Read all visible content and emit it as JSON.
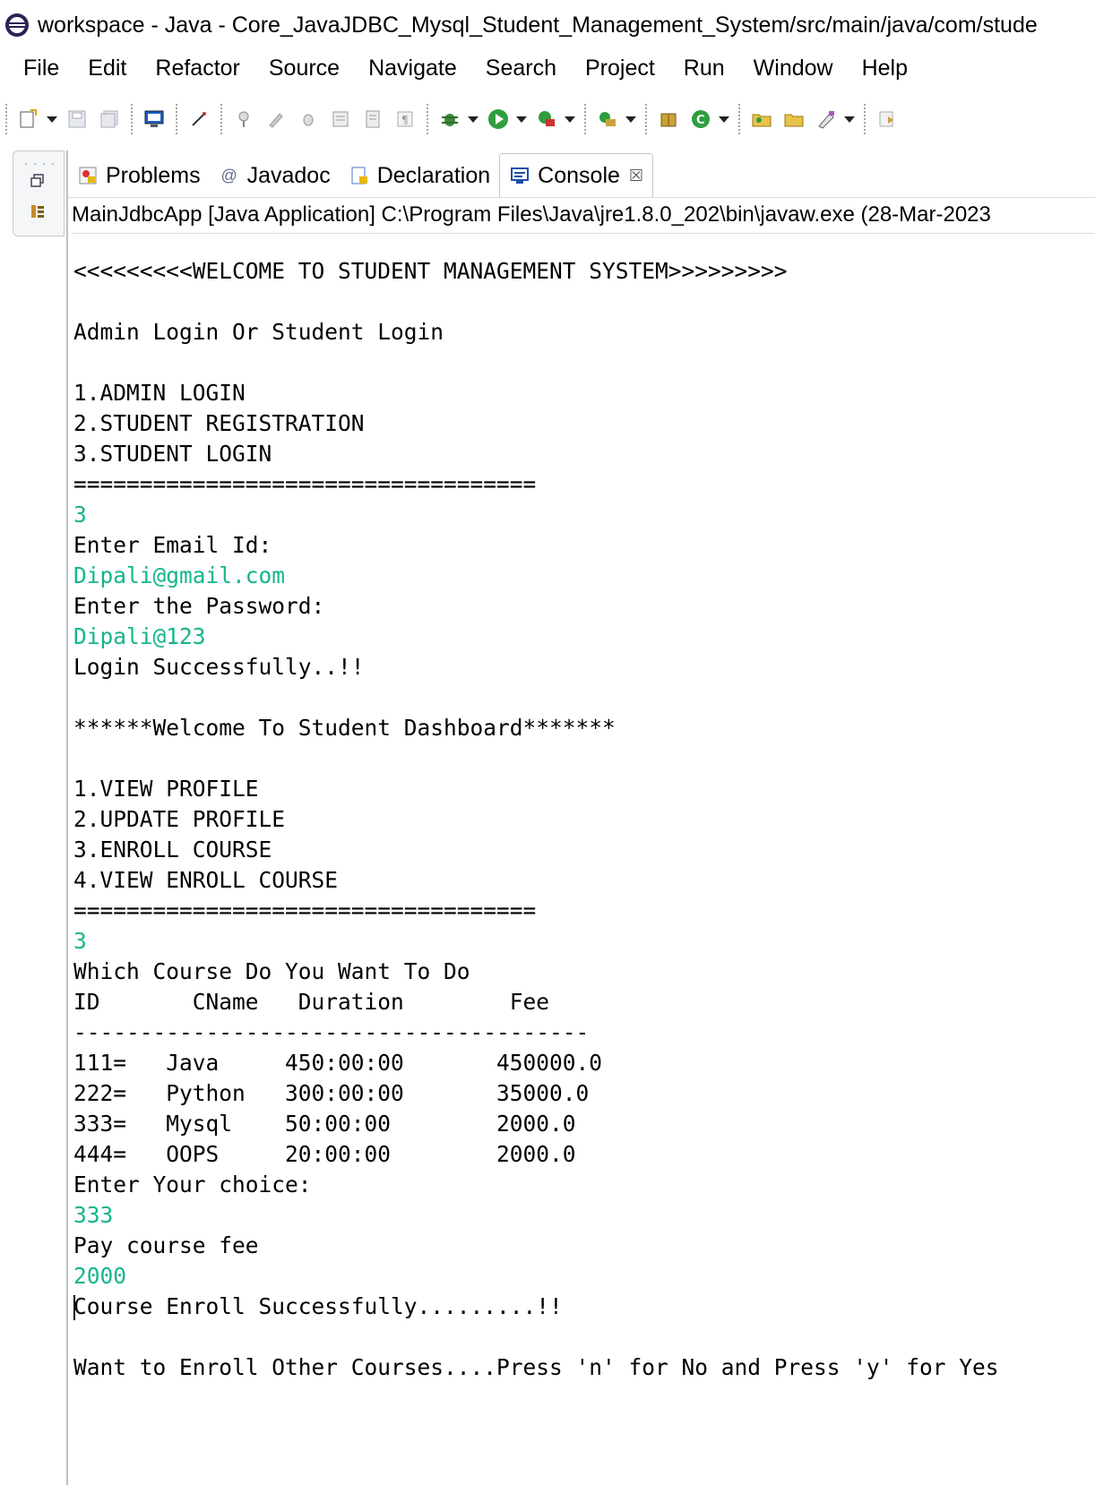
{
  "window": {
    "title": "workspace - Java - Core_JavaJDBC_Mysql_Student_Management_System/src/main/java/com/stude"
  },
  "menu": [
    "File",
    "Edit",
    "Refactor",
    "Source",
    "Navigate",
    "Search",
    "Project",
    "Run",
    "Window",
    "Help"
  ],
  "tabs": [
    {
      "label": "Problems",
      "icon": "problems-icon"
    },
    {
      "label": "Javadoc",
      "icon": "at-icon"
    },
    {
      "label": "Declaration",
      "icon": "declaration-icon"
    },
    {
      "label": "Console",
      "icon": "console-icon",
      "active": true,
      "close": "☒"
    }
  ],
  "launch_info": "MainJdbcApp [Java Application] C:\\Program Files\\Java\\jre1.8.0_202\\bin\\javaw.exe (28-Mar-2023",
  "colors": {
    "input_text": "#14b58c"
  },
  "console_lines": [
    {
      "text": "<<<<<<<<<WELCOME TO STUDENT MANAGEMENT SYSTEM>>>>>>>>>",
      "input": false
    },
    {
      "text": "",
      "input": false
    },
    {
      "text": "Admin Login Or Student Login",
      "input": false
    },
    {
      "text": "",
      "input": false
    },
    {
      "text": "1.ADMIN LOGIN",
      "input": false
    },
    {
      "text": "2.STUDENT REGISTRATION",
      "input": false
    },
    {
      "text": "3.STUDENT LOGIN",
      "input": false
    },
    {
      "text": "===================================",
      "input": false
    },
    {
      "text": "3",
      "input": true
    },
    {
      "text": "Enter Email Id:",
      "input": false
    },
    {
      "text": "Dipali@gmail.com",
      "input": true
    },
    {
      "text": "Enter the Password:",
      "input": false
    },
    {
      "text": "Dipali@123",
      "input": true
    },
    {
      "text": "Login Successfully..!!",
      "input": false
    },
    {
      "text": "",
      "input": false
    },
    {
      "text": "******Welcome To Student Dashboard*******",
      "input": false
    },
    {
      "text": "",
      "input": false
    },
    {
      "text": "1.VIEW PROFILE",
      "input": false
    },
    {
      "text": "2.UPDATE PROFILE",
      "input": false
    },
    {
      "text": "3.ENROLL COURSE",
      "input": false
    },
    {
      "text": "4.VIEW ENROLL COURSE",
      "input": false
    },
    {
      "text": "===================================",
      "input": false
    },
    {
      "text": "3",
      "input": true
    },
    {
      "text": "Which Course Do You Want To Do",
      "input": false
    },
    {
      "text": "ID       CName   Duration        Fee",
      "input": false
    },
    {
      "text": "---------------------------------------",
      "input": false
    },
    {
      "text": "111=   Java     450:00:00       450000.0",
      "input": false
    },
    {
      "text": "222=   Python   300:00:00       35000.0",
      "input": false
    },
    {
      "text": "333=   Mysql    50:00:00        2000.0",
      "input": false
    },
    {
      "text": "444=   OOPS     20:00:00        2000.0",
      "input": false
    },
    {
      "text": "Enter Your choice:",
      "input": false
    },
    {
      "text": "333",
      "input": true
    },
    {
      "text": "Pay course fee",
      "input": false
    },
    {
      "text": "2000",
      "input": true
    },
    {
      "text": "Course Enroll Successfully.........!!",
      "input": false,
      "caret": true
    },
    {
      "text": "",
      "input": false
    },
    {
      "text": "Want to Enroll Other Courses....Press 'n' for No and Press 'y' for Yes",
      "input": false
    }
  ]
}
